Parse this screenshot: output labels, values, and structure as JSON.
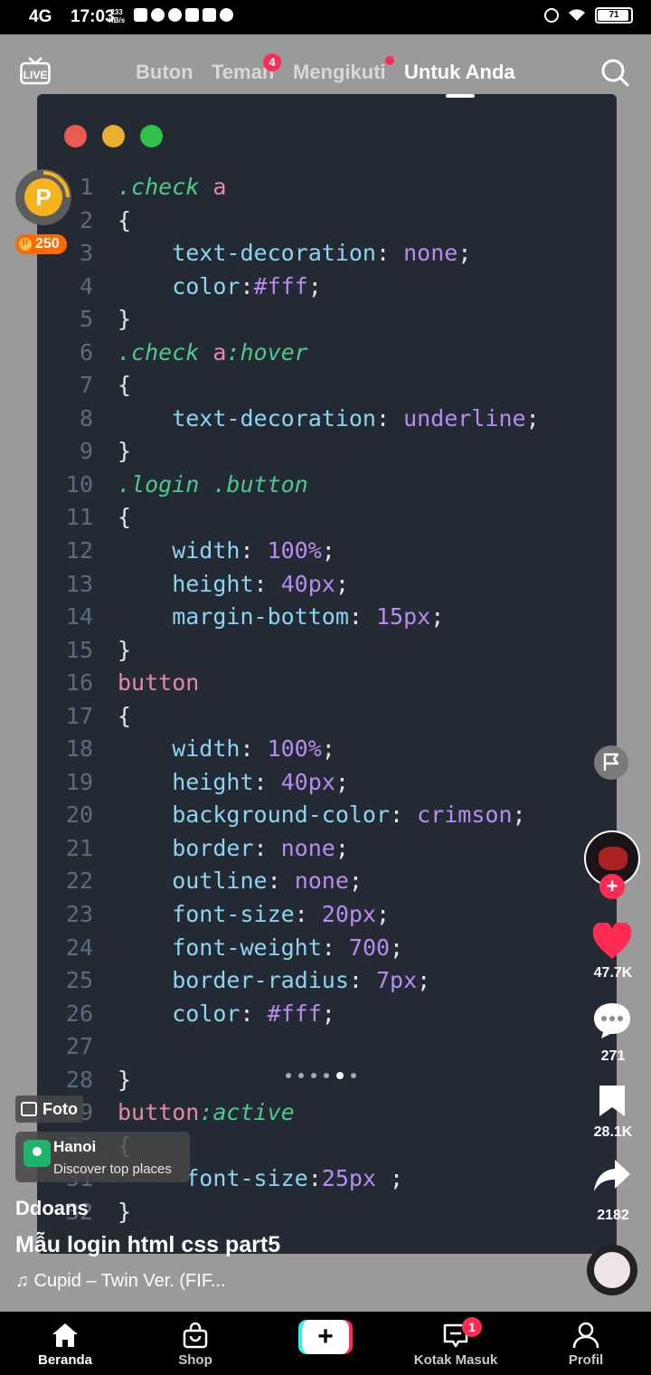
{
  "status_bar": {
    "network": "4G",
    "time": "17:03",
    "speed_value": "233",
    "speed_unit": "KB/s",
    "battery": "71"
  },
  "header": {
    "live_label": "LIVE",
    "tabs": [
      {
        "label": "Buton"
      },
      {
        "label": "Teman",
        "badge": "4"
      },
      {
        "label": "Mengikuti"
      },
      {
        "label": "Untuk Anda"
      }
    ]
  },
  "coins": {
    "amount": "250",
    "coin_letter": "P"
  },
  "code": {
    "lines": [
      {
        "n": "1",
        "parts": [
          {
            "t": ".check",
            "c": "sel"
          },
          {
            "t": " a",
            "c": "tag"
          }
        ]
      },
      {
        "n": "2",
        "parts": [
          {
            "t": "{",
            "c": "br"
          }
        ]
      },
      {
        "n": "3",
        "parts": [
          {
            "t": "    text-decoration",
            "c": "prop"
          },
          {
            "t": ": ",
            "c": "br"
          },
          {
            "t": "none",
            "c": "val"
          },
          {
            "t": ";",
            "c": "br"
          }
        ]
      },
      {
        "n": "4",
        "parts": [
          {
            "t": "    color",
            "c": "prop"
          },
          {
            "t": ":",
            "c": "br"
          },
          {
            "t": "#fff",
            "c": "val"
          },
          {
            "t": ";",
            "c": "br"
          }
        ]
      },
      {
        "n": "5",
        "parts": [
          {
            "t": "}",
            "c": "br"
          }
        ]
      },
      {
        "n": "6",
        "parts": [
          {
            "t": ".check",
            "c": "sel"
          },
          {
            "t": " a",
            "c": "tag"
          },
          {
            "t": ":hover",
            "c": "sel"
          }
        ]
      },
      {
        "n": "7",
        "parts": [
          {
            "t": "{",
            "c": "br"
          }
        ]
      },
      {
        "n": "8",
        "parts": [
          {
            "t": "    text-decoration",
            "c": "prop"
          },
          {
            "t": ": ",
            "c": "br"
          },
          {
            "t": "underline",
            "c": "val"
          },
          {
            "t": ";",
            "c": "br"
          }
        ]
      },
      {
        "n": "9",
        "parts": [
          {
            "t": "}",
            "c": "br"
          }
        ]
      },
      {
        "n": "10",
        "parts": [
          {
            "t": ".login .button",
            "c": "sel"
          }
        ]
      },
      {
        "n": "11",
        "parts": [
          {
            "t": "{",
            "c": "br"
          }
        ]
      },
      {
        "n": "12",
        "parts": [
          {
            "t": "    width",
            "c": "prop"
          },
          {
            "t": ": ",
            "c": "br"
          },
          {
            "t": "100%",
            "c": "val"
          },
          {
            "t": ";",
            "c": "br"
          }
        ]
      },
      {
        "n": "13",
        "parts": [
          {
            "t": "    height",
            "c": "prop"
          },
          {
            "t": ": ",
            "c": "br"
          },
          {
            "t": "40px",
            "c": "val"
          },
          {
            "t": ";",
            "c": "br"
          }
        ]
      },
      {
        "n": "14",
        "parts": [
          {
            "t": "    margin-bottom",
            "c": "prop"
          },
          {
            "t": ": ",
            "c": "br"
          },
          {
            "t": "15px",
            "c": "val"
          },
          {
            "t": ";",
            "c": "br"
          }
        ]
      },
      {
        "n": "15",
        "parts": [
          {
            "t": "}",
            "c": "br"
          }
        ]
      },
      {
        "n": "16",
        "parts": [
          {
            "t": "button",
            "c": "tag"
          }
        ]
      },
      {
        "n": "17",
        "parts": [
          {
            "t": "{",
            "c": "br"
          }
        ]
      },
      {
        "n": "18",
        "parts": [
          {
            "t": "    width",
            "c": "prop"
          },
          {
            "t": ": ",
            "c": "br"
          },
          {
            "t": "100%",
            "c": "val"
          },
          {
            "t": ";",
            "c": "br"
          }
        ]
      },
      {
        "n": "19",
        "parts": [
          {
            "t": "    height",
            "c": "prop"
          },
          {
            "t": ": ",
            "c": "br"
          },
          {
            "t": "40px",
            "c": "val"
          },
          {
            "t": ";",
            "c": "br"
          }
        ]
      },
      {
        "n": "20",
        "parts": [
          {
            "t": "    background-color",
            "c": "prop"
          },
          {
            "t": ": ",
            "c": "br"
          },
          {
            "t": "crimson",
            "c": "val"
          },
          {
            "t": ";",
            "c": "br"
          }
        ]
      },
      {
        "n": "21",
        "parts": [
          {
            "t": "    border",
            "c": "prop"
          },
          {
            "t": ": ",
            "c": "br"
          },
          {
            "t": "none",
            "c": "val"
          },
          {
            "t": ";",
            "c": "br"
          }
        ]
      },
      {
        "n": "22",
        "parts": [
          {
            "t": "    outline",
            "c": "prop"
          },
          {
            "t": ": ",
            "c": "br"
          },
          {
            "t": "none",
            "c": "val"
          },
          {
            "t": ";",
            "c": "br"
          }
        ]
      },
      {
        "n": "23",
        "parts": [
          {
            "t": "    font-size",
            "c": "prop"
          },
          {
            "t": ": ",
            "c": "br"
          },
          {
            "t": "20px",
            "c": "val"
          },
          {
            "t": ";",
            "c": "br"
          }
        ]
      },
      {
        "n": "24",
        "parts": [
          {
            "t": "    font-weight",
            "c": "prop"
          },
          {
            "t": ": ",
            "c": "br"
          },
          {
            "t": "700",
            "c": "val"
          },
          {
            "t": ";",
            "c": "br"
          }
        ]
      },
      {
        "n": "25",
        "parts": [
          {
            "t": "    border-radius",
            "c": "prop"
          },
          {
            "t": ": ",
            "c": "br"
          },
          {
            "t": "7px",
            "c": "val"
          },
          {
            "t": ";",
            "c": "br"
          }
        ]
      },
      {
        "n": "26",
        "parts": [
          {
            "t": "    color",
            "c": "prop"
          },
          {
            "t": ": ",
            "c": "br"
          },
          {
            "t": "#fff",
            "c": "val"
          },
          {
            "t": ";",
            "c": "br"
          }
        ]
      },
      {
        "n": "27",
        "parts": []
      },
      {
        "n": "28",
        "parts": [
          {
            "t": "}",
            "c": "br"
          }
        ]
      },
      {
        "n": "29",
        "parts": [
          {
            "t": "button",
            "c": "tag"
          },
          {
            "t": ":active",
            "c": "sel"
          }
        ]
      },
      {
        "n": "30",
        "parts": [
          {
            "t": "{",
            "c": "br"
          }
        ]
      },
      {
        "n": "31",
        "parts": [
          {
            "t": "     font-size",
            "c": "prop"
          },
          {
            "t": ":",
            "c": "br"
          },
          {
            "t": "25px",
            "c": "val"
          },
          {
            "t": " ;",
            "c": "br"
          }
        ]
      },
      {
        "n": "32",
        "parts": [
          {
            "t": "}",
            "c": "br"
          }
        ]
      }
    ]
  },
  "pager": {
    "count": 6,
    "active": 4
  },
  "actions": {
    "likes": "47.7K",
    "comments": "271",
    "saves": "28.1K",
    "shares": "2182"
  },
  "overlay": {
    "photo_label": "Foto",
    "place_city": "Hanoi",
    "place_sub": "Discover top places",
    "author": "Ddoans",
    "caption": "Mẫu login html css part5",
    "song": "♫ Cupid – Twin Ver. (FIF..."
  },
  "nav": {
    "home": "Beranda",
    "shop": "Shop",
    "create": "+",
    "inbox": "Kotak Masuk",
    "inbox_badge": "1",
    "profile": "Profil"
  },
  "colors": {
    "accent": "#fe2c55",
    "editor_bg": "#242a33",
    "selector": "#4ec98a",
    "property": "#8cd4f0",
    "value": "#b78cf0",
    "tag": "#e48aa6",
    "window_red": "#ed5a54",
    "window_yellow": "#e8b02e",
    "window_green": "#2fc24a"
  }
}
